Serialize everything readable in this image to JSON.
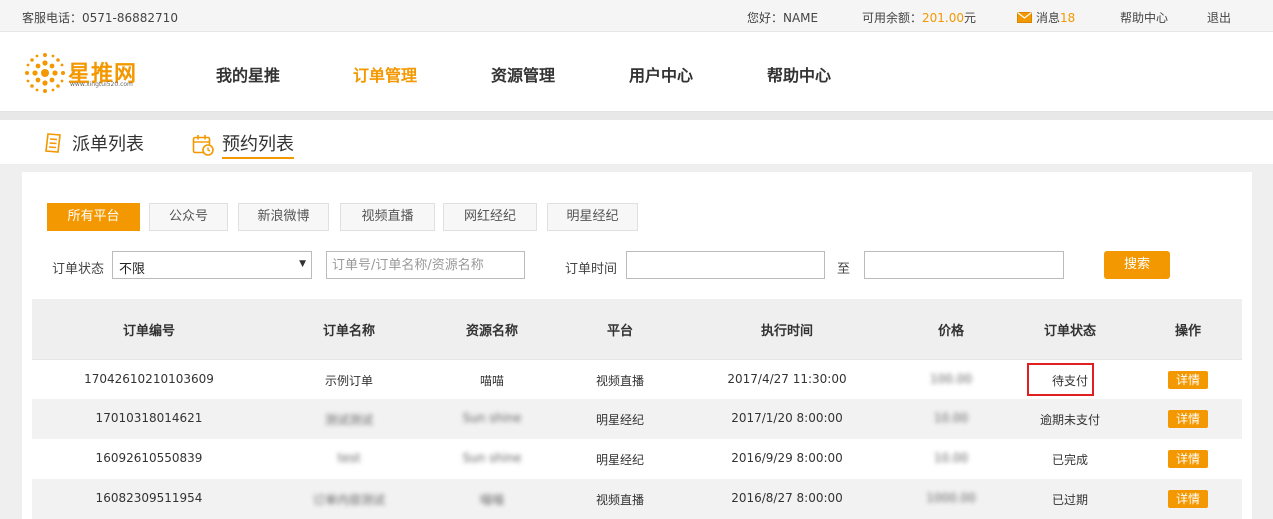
{
  "topbar": {
    "phone": "客服电话：0571-86882710",
    "greeting": "您好：NAME",
    "balance_label": "可用余额：",
    "balance_value": "201.00",
    "balance_unit": "元",
    "messages_label": "消息",
    "messages_count": "18",
    "help": "帮助中心",
    "logout": "退出"
  },
  "logo": {
    "name": "星推网",
    "url": "www.xingtui520.com"
  },
  "nav": [
    {
      "label": "我的星推"
    },
    {
      "label": "订单管理",
      "active": true
    },
    {
      "label": "资源管理"
    },
    {
      "label": "用户中心"
    },
    {
      "label": "帮助中心"
    }
  ],
  "subtabs": [
    {
      "label": "派单列表"
    },
    {
      "label": "预约列表",
      "active": true
    }
  ],
  "platforms": [
    {
      "label": "所有平台",
      "active": true
    },
    {
      "label": "公众号"
    },
    {
      "label": "新浪微博"
    },
    {
      "label": "视频直播"
    },
    {
      "label": "网红经纪"
    },
    {
      "label": "明星经纪"
    }
  ],
  "filters": {
    "status_label": "订单状态",
    "status_value": "不限",
    "keyword_placeholder": "订单号/订单名称/资源名称",
    "time_label": "订单时间",
    "to_label": "至",
    "search_button": "搜索"
  },
  "table": {
    "columns": [
      "订单编号",
      "订单名称",
      "资源名称",
      "平台",
      "执行时间",
      "价格",
      "订单状态",
      "操作"
    ],
    "rows": [
      {
        "id": "17042610210103609",
        "name": "示例订单",
        "resource": "喵喵",
        "platform": "视频直播",
        "time": "2017/4/27 11:30:00",
        "price": "100.00",
        "status": "待支付",
        "action": "详情"
      },
      {
        "id": "17010318014621",
        "name": "测试测试",
        "resource": "Sun shine",
        "platform": "明星经纪",
        "time": "2017/1/20 8:00:00",
        "price": "10.00",
        "status": "逾期未支付",
        "action": "详情"
      },
      {
        "id": "16092610550839",
        "name": "test",
        "resource": "Sun shine",
        "platform": "明星经纪",
        "time": "2016/9/29 8:00:00",
        "price": "10.00",
        "status": "已完成",
        "action": "详情"
      },
      {
        "id": "16082309511954",
        "name": "订单内容测试",
        "resource": "喵喵",
        "platform": "视频直播",
        "time": "2016/8/27 8:00:00",
        "price": "1000.00",
        "status": "已过期",
        "action": "详情"
      }
    ]
  },
  "colors": {
    "accent": "#f39800",
    "link": "#1a6fb8",
    "highlight": "#e02020"
  }
}
